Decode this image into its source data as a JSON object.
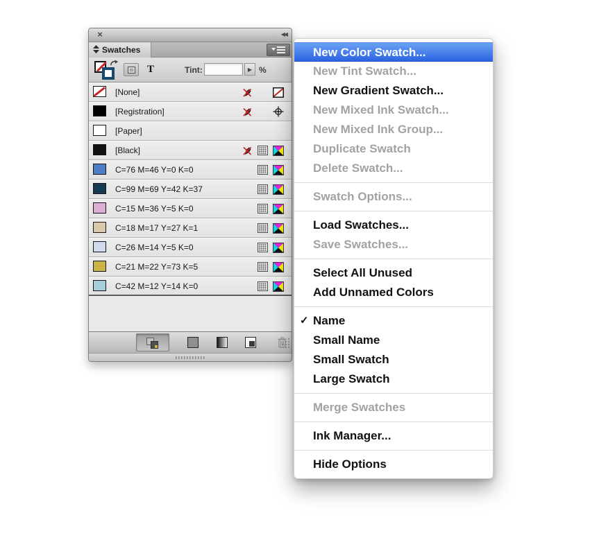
{
  "colors": {
    "menu_highlight_top": "#6ba1f4",
    "menu_highlight_bottom": "#2c64e2",
    "stroke_proxy": "#17496f",
    "none_slash_red": "#c62828"
  },
  "window": {
    "close_icon": "×",
    "collapse_icon": "◀◀"
  },
  "panel": {
    "tab_label": "Swatches",
    "toolbar": {
      "tint_label": "Tint:",
      "tint_value": "",
      "stepper_icon": "▶",
      "percent_label": "%",
      "text_button_label": "T"
    },
    "swatches": [
      {
        "name": "[None]",
        "color": "none",
        "icons": [
          "pen-x",
          "none"
        ]
      },
      {
        "name": "[Registration]",
        "color": "#000000",
        "icons": [
          "pen-x",
          "registration"
        ]
      },
      {
        "name": "[Paper]",
        "color": "#ffffff",
        "icons": []
      },
      {
        "name": "[Black]",
        "color": "#121212",
        "icons": [
          "pen-x",
          "process",
          "cmyk"
        ]
      },
      {
        "name": "C=76 M=46 Y=0 K=0",
        "color": "#4d7ec5",
        "icons": [
          "process",
          "cmyk"
        ]
      },
      {
        "name": "C=99 M=69 Y=42 K=37",
        "color": "#173a50",
        "icons": [
          "process",
          "cmyk"
        ]
      },
      {
        "name": "C=15 M=36 Y=5 K=0",
        "color": "#dcaed0",
        "icons": [
          "process",
          "cmyk"
        ]
      },
      {
        "name": "C=18 M=17 Y=27 K=1",
        "color": "#d8c9ab",
        "icons": [
          "process",
          "cmyk"
        ]
      },
      {
        "name": "C=26 M=14 Y=5 K=0",
        "color": "#cfdbea",
        "icons": [
          "process",
          "cmyk"
        ]
      },
      {
        "name": "C=21 M=22 Y=73 K=5",
        "color": "#c9b449",
        "icons": [
          "process",
          "cmyk"
        ]
      },
      {
        "name": "C=42 M=12 Y=14 K=0",
        "color": "#a7cfda",
        "icons": [
          "process",
          "cmyk"
        ]
      }
    ]
  },
  "menu": {
    "check_icon": "✓",
    "sections": [
      [
        {
          "label": "New Color Swatch...",
          "state": "highlighted"
        },
        {
          "label": "New Tint Swatch...",
          "state": "disabled"
        },
        {
          "label": "New Gradient Swatch...",
          "state": "enabled"
        },
        {
          "label": "New Mixed Ink Swatch...",
          "state": "disabled"
        },
        {
          "label": "New Mixed Ink Group...",
          "state": "disabled"
        },
        {
          "label": "Duplicate Swatch",
          "state": "disabled"
        },
        {
          "label": "Delete Swatch...",
          "state": "disabled"
        }
      ],
      [
        {
          "label": "Swatch Options...",
          "state": "disabled"
        }
      ],
      [
        {
          "label": "Load Swatches...",
          "state": "enabled"
        },
        {
          "label": "Save Swatches...",
          "state": "disabled"
        }
      ],
      [
        {
          "label": "Select All Unused",
          "state": "enabled"
        },
        {
          "label": "Add Unnamed Colors",
          "state": "enabled"
        }
      ],
      [
        {
          "label": "Name",
          "state": "enabled",
          "checked": true
        },
        {
          "label": "Small Name",
          "state": "enabled"
        },
        {
          "label": "Small Swatch",
          "state": "enabled"
        },
        {
          "label": "Large Swatch",
          "state": "enabled"
        }
      ],
      [
        {
          "label": "Merge Swatches",
          "state": "disabled"
        }
      ],
      [
        {
          "label": "Ink Manager...",
          "state": "enabled"
        }
      ],
      [
        {
          "label": "Hide Options",
          "state": "enabled"
        }
      ]
    ]
  }
}
